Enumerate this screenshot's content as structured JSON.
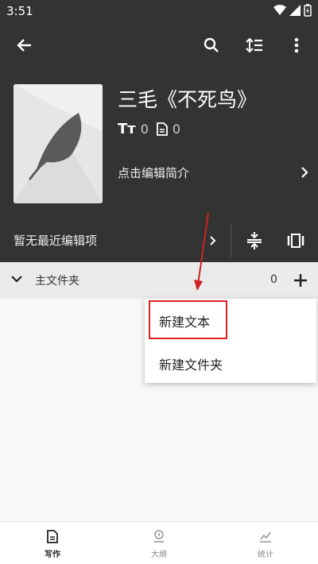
{
  "status_bar": {
    "time": "3:51"
  },
  "app_bar": {
    "back_icon": "arrow-left-icon",
    "search_icon": "search-icon",
    "sort_icon": "sort-icon",
    "more_icon": "more-vert-icon"
  },
  "book": {
    "title": "三毛《不死鸟》",
    "word_count": "0",
    "doc_count": "0",
    "intro_link": "点击编辑简介"
  },
  "recent": {
    "label": "暂无最近编辑项"
  },
  "folder": {
    "name": "主文件夹",
    "count": "0"
  },
  "popup_menu": {
    "items": [
      "新建文本",
      "新建文件夹"
    ]
  },
  "bottom_nav": {
    "items": [
      "写作",
      "大纲",
      "统计"
    ],
    "active": "写作"
  },
  "colors": {
    "header_bg": "#333333",
    "highlight": "#dd2222",
    "arrow": "#cc2222"
  }
}
